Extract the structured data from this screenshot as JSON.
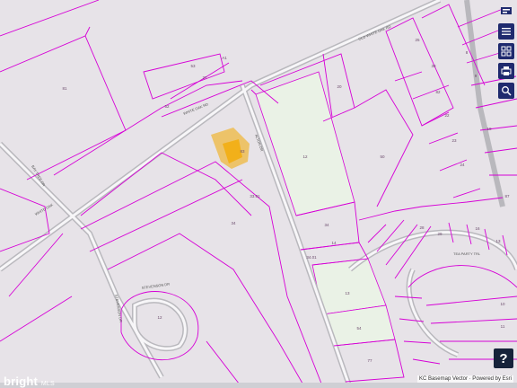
{
  "colors": {
    "parcel_line": "#d600d6",
    "background": "#e7e3e8",
    "green_lot": "#eaf2e6",
    "road": "#b9b8bd",
    "building": "#f3a900",
    "toolbar": "#1f2a6e"
  },
  "toolbar": {
    "icons": [
      "layers-icon",
      "list-icon",
      "grid-icon",
      "print-icon",
      "search-icon"
    ]
  },
  "map": {
    "parcel_labels": [
      "81",
      "27",
      "53",
      "52",
      "A1",
      "20",
      "25",
      "38",
      "12",
      "50",
      "82",
      "34",
      "33.01",
      "34",
      "14",
      "8",
      "9",
      "22",
      "23",
      "24",
      "18",
      "13",
      "34.01",
      "54",
      "28",
      "29",
      "16",
      "13",
      "10",
      "11",
      "77",
      "83",
      "12",
      "87"
    ],
    "road_labels": [
      "WHITE OAK RD",
      "OLD WHITE OAK RD",
      "ALTON DR",
      "STEVENSON DR",
      "STEVENSON DR",
      "TEA PARTY TRL",
      "BAY TREE DR",
      "WHITE OAK"
    ]
  },
  "footer": {
    "attribution": "KC Basemap Vector · Powered by Esri",
    "logo": "bright",
    "logo_suffix": "MLS",
    "help": "?"
  }
}
